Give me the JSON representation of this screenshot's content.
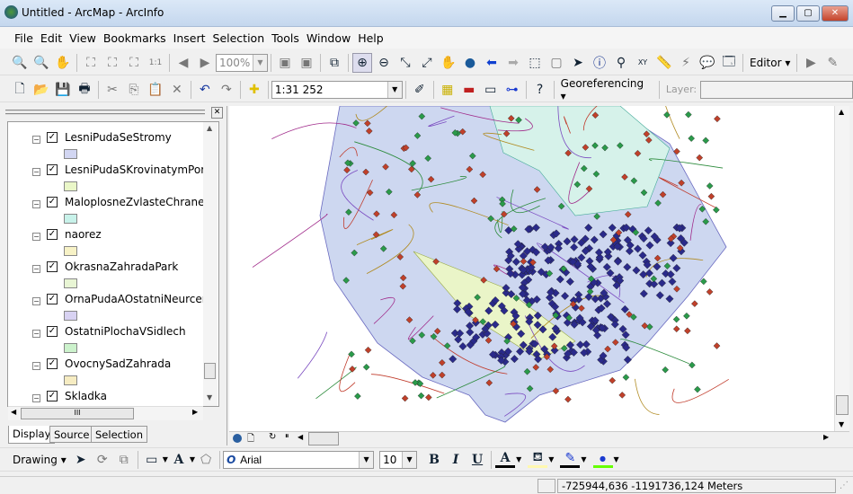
{
  "window": {
    "title": "Untitled - ArcMap - ArcInfo",
    "min": "▁",
    "max": "▢",
    "close": "✕"
  },
  "menu": [
    "File",
    "Edit",
    "View",
    "Bookmarks",
    "Insert",
    "Selection",
    "Tools",
    "Window",
    "Help"
  ],
  "toolbar1": {
    "zoom_percent": "100%",
    "editor_label": "Editor"
  },
  "toolbar2": {
    "scale": "1:31 252",
    "georef_label": "Georeferencing",
    "layer_label": "Layer:",
    "layer_value": ""
  },
  "toc": {
    "layers": [
      {
        "name": "LesniPudaSeStromy",
        "color": "#d2d6f2"
      },
      {
        "name": "LesniPudaSKrovinatymPorost",
        "color": "#eaf7c8"
      },
      {
        "name": "MaloplosneZvlasteChraneneU",
        "color": "#c8f2ea"
      },
      {
        "name": "naorez",
        "color": "#f7f2c6"
      },
      {
        "name": "OkrasnaZahradaPark",
        "color": "#e8f5d4"
      },
      {
        "name": "OrnaPudaAOstatniNeurceneP",
        "color": "#d8d2f2"
      },
      {
        "name": "OstatniPlochaVSidlech",
        "color": "#ccf2cc"
      },
      {
        "name": "OvocnySadZahrada",
        "color": "#f6ecc2"
      },
      {
        "name": "Skladka",
        "color": "#d8f0d8"
      }
    ],
    "tabs": [
      "Display",
      "Source",
      "Selection"
    ],
    "hscroll_label": "III"
  },
  "drawing": {
    "label": "Drawing",
    "font": "Arial",
    "size": "10",
    "bold": "B",
    "italic": "I",
    "underline": "U",
    "text_color_glyph": "A"
  },
  "status": {
    "coords": "-725944,636  -1191736,124 Meters"
  }
}
